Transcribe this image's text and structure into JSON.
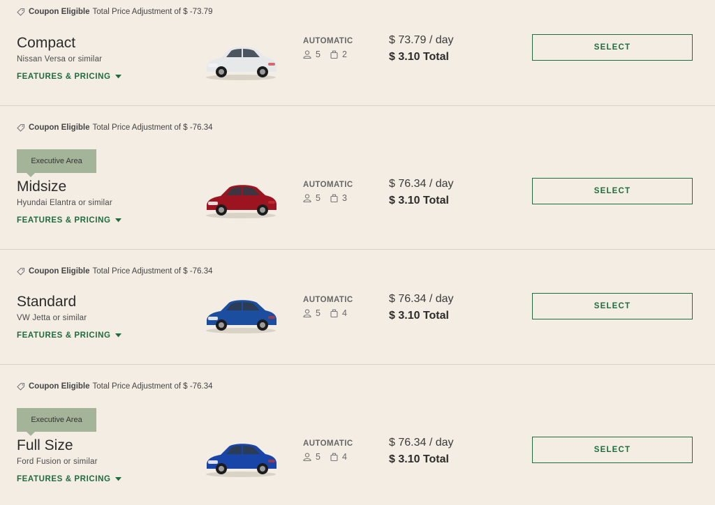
{
  "cars": [
    {
      "coupon_label": "Coupon Eligible",
      "adjustment_text": "Total Price Adjustment of $ -73.79",
      "badge": "",
      "class_name": "Compact",
      "similar": "Nissan Versa or similar",
      "features_label": "FEATURES & PRICING",
      "transmission": "AUTOMATIC",
      "passengers": "5",
      "bags": "2",
      "per_day": "$ 73.79 / day",
      "total": "$ 3.10 Total",
      "select_label": "SELECT",
      "car_color": "#e6e8ea"
    },
    {
      "coupon_label": "Coupon Eligible",
      "adjustment_text": "Total Price Adjustment of $ -76.34",
      "badge": "Executive Area",
      "class_name": "Midsize",
      "similar": "Hyundai Elantra or similar",
      "features_label": "FEATURES & PRICING",
      "transmission": "AUTOMATIC",
      "passengers": "5",
      "bags": "3",
      "per_day": "$ 76.34 / day",
      "total": "$ 3.10 Total",
      "select_label": "SELECT",
      "car_color": "#9b1420"
    },
    {
      "coupon_label": "Coupon Eligible",
      "adjustment_text": "Total Price Adjustment of $ -76.34",
      "badge": "",
      "class_name": "Standard",
      "similar": "VW Jetta or similar",
      "features_label": "FEATURES & PRICING",
      "transmission": "AUTOMATIC",
      "passengers": "5",
      "bags": "4",
      "per_day": "$ 76.34 / day",
      "total": "$ 3.10 Total",
      "select_label": "SELECT",
      "car_color": "#1c4ea0"
    },
    {
      "coupon_label": "Coupon Eligible",
      "adjustment_text": "Total Price Adjustment of $ -76.34",
      "badge": "Executive Area",
      "class_name": "Full Size",
      "similar": "Ford Fusion or similar",
      "features_label": "FEATURES & PRICING",
      "transmission": "AUTOMATIC",
      "passengers": "5",
      "bags": "4",
      "per_day": "$ 76.34 / day",
      "total": "$ 3.10 Total",
      "select_label": "SELECT",
      "car_color": "#1a45a8"
    }
  ],
  "colors": {
    "background": "#f3ede4",
    "accent_green": "#1f6b3f",
    "badge_green": "#a4b498"
  },
  "icons": {
    "coupon": "tag-icon",
    "features": "caret-down-icon",
    "passengers": "person-icon",
    "bags": "bag-icon"
  }
}
